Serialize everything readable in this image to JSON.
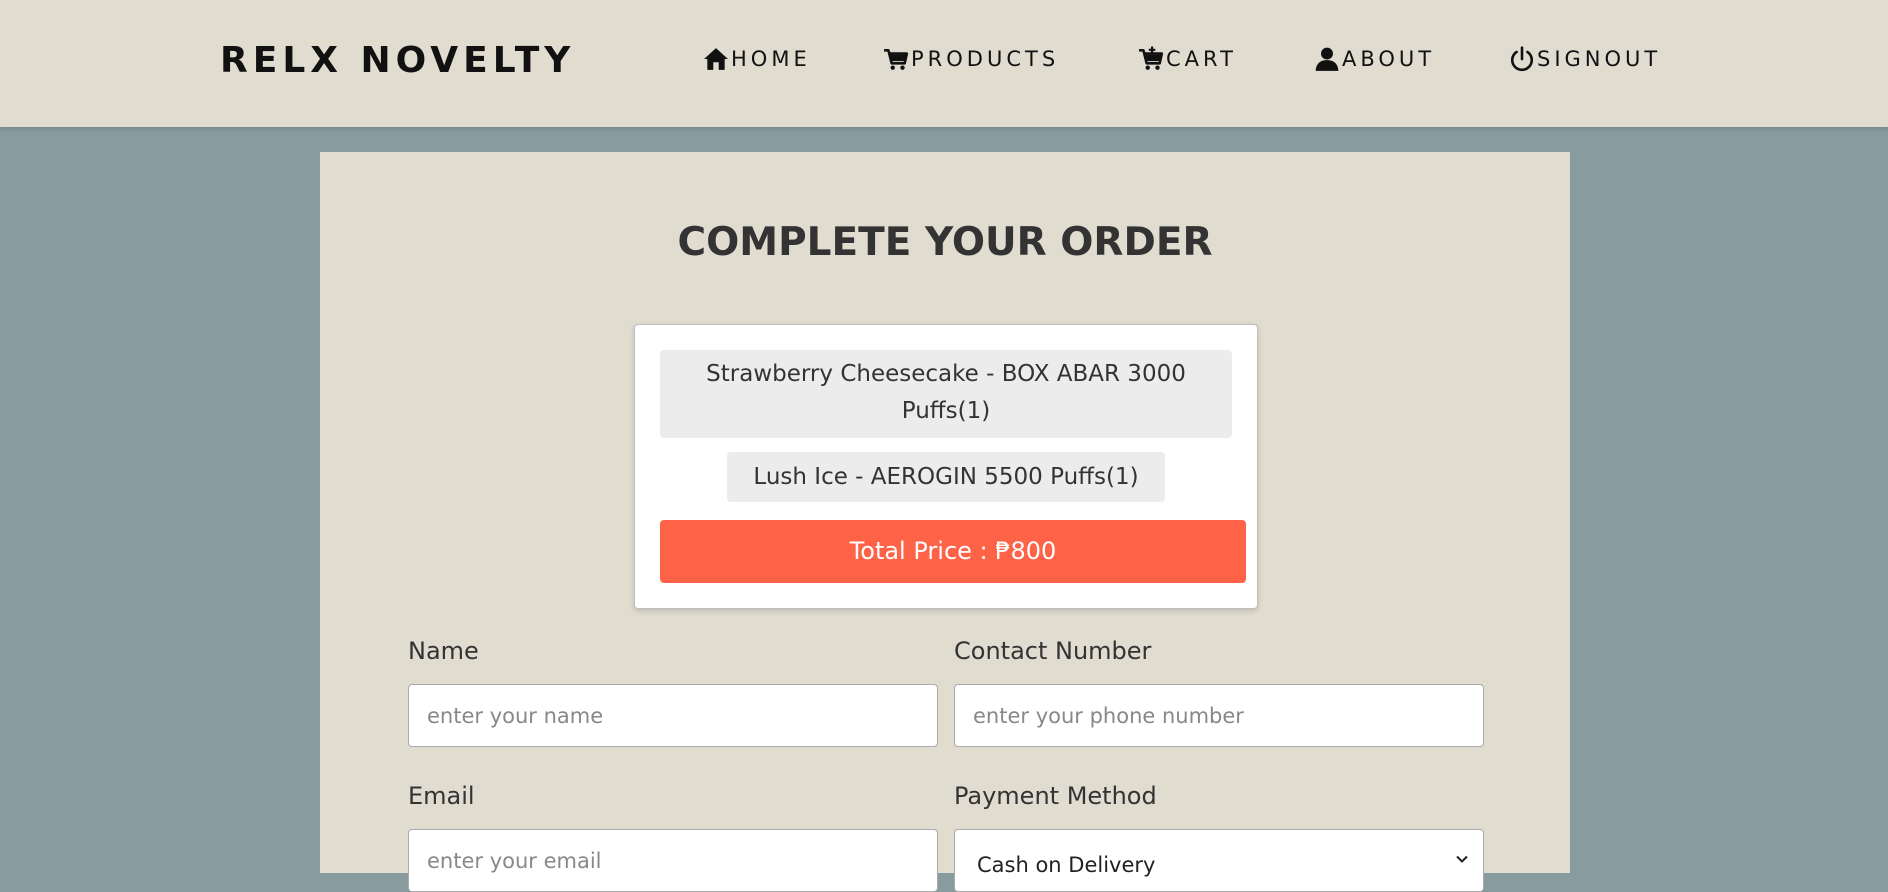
{
  "header": {
    "logo": "RELX NOVELTY",
    "nav": [
      {
        "label": "HOME",
        "icon": "home-icon"
      },
      {
        "label": "PRODUCTS",
        "icon": "cart-icon"
      },
      {
        "label": "CART",
        "icon": "cart-plus-icon"
      },
      {
        "label": "ABOUT",
        "icon": "user-icon"
      },
      {
        "label": "SIGNOUT",
        "icon": "power-icon"
      }
    ]
  },
  "main": {
    "title": "COMPLETE YOUR ORDER",
    "order_summary": {
      "items": [
        "Strawberry Cheesecake - BOX ABAR 3000 Puffs(1)",
        "Lush Ice - AEROGIN 5500 Puffs(1)"
      ],
      "total_price": "Total Price : ₱800"
    },
    "form": {
      "name_label": "Name",
      "name_placeholder": "enter your name",
      "contact_label": "Contact Number",
      "contact_placeholder": "enter your phone number",
      "email_label": "Email",
      "email_placeholder": "enter your email",
      "payment_label": "Payment Method",
      "payment_selected": "Cash on Delivery"
    }
  },
  "colors": {
    "page_background": "#889ca0",
    "panel_background": "#e0dcd0",
    "accent": "#ff6347"
  }
}
